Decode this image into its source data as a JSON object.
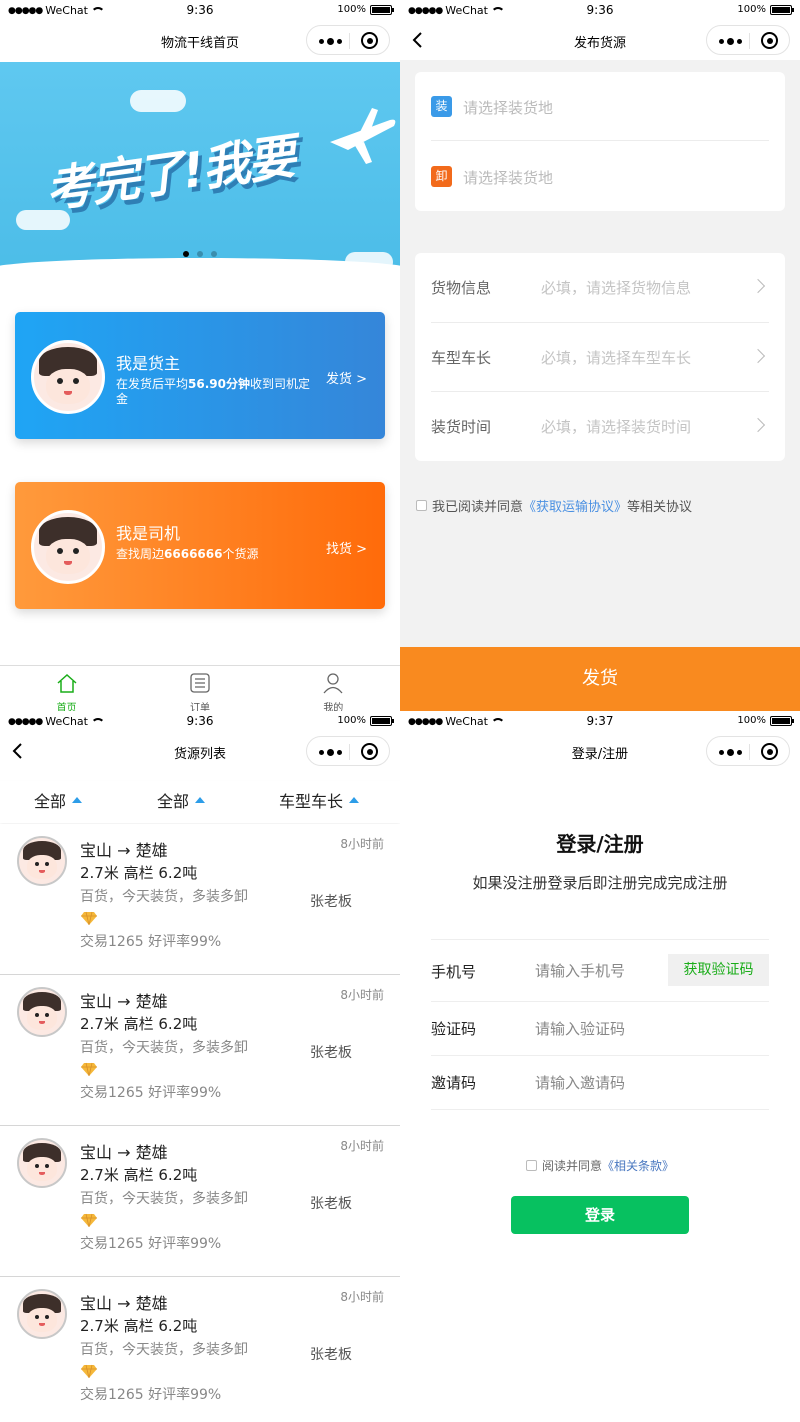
{
  "status": {
    "carrier": "WeChat",
    "battery": "100%",
    "time_1": "9:36",
    "time_2": "9:36",
    "time_3": "9:36",
    "time_4": "9:37"
  },
  "home": {
    "nav_title": "物流干线首页",
    "banner_text": "考完了!我要",
    "banner_slide_count": 3,
    "banner_active_index": 0,
    "shipper": {
      "title": "我是货主",
      "desc_prefix": "在发货后平均",
      "desc_value": "56.90分钟",
      "desc_suffix": "收到司机定金",
      "action": "发货 >",
      "color_start": "#1fa5f5",
      "color_end": "#3586d9"
    },
    "driver": {
      "title": "我是司机",
      "desc_prefix": "查找周边",
      "desc_value": "6666666",
      "desc_suffix": "个货源",
      "action": "找货 >",
      "color_start": "#ff9a3c",
      "color_end": "#ff6b0a"
    },
    "tabs": [
      {
        "label": "首页",
        "icon": "home-icon",
        "active": true
      },
      {
        "label": "订单",
        "icon": "list-icon",
        "active": false
      },
      {
        "label": "我的",
        "icon": "user-icon",
        "active": false
      }
    ],
    "active_color": "#1aad19"
  },
  "publish": {
    "nav_title": "发布货源",
    "load_tag": "装",
    "load_placeholder": "请选择装货地",
    "unload_tag": "卸",
    "unload_placeholder": "请选择装货地",
    "rows": [
      {
        "label": "货物信息",
        "placeholder": "必填，请选择货物信息"
      },
      {
        "label": "车型车长",
        "placeholder": "必填，请选择车型车长"
      },
      {
        "label": "装货时间",
        "placeholder": "必填，请选择装货时间"
      }
    ],
    "agree_prefix": "我已阅读并同意",
    "agree_link": "《获取运输协议》",
    "agree_suffix": "等相关协议",
    "submit": "发货",
    "submit_color": "#f98a1f"
  },
  "list": {
    "nav_title": "货源列表",
    "filters": [
      "全部",
      "全部",
      "车型车长"
    ],
    "items": [
      {
        "route": "宝山 → 楚雄",
        "spec": "2.7米 高栏 6.2吨",
        "goods": "百货，今天装货，多装多卸",
        "stats": "交易1265 好评率99%",
        "ago": "8小时前",
        "name": "张老板"
      },
      {
        "route": "宝山 → 楚雄",
        "spec": "2.7米 高栏 6.2吨",
        "goods": "百货，今天装货，多装多卸",
        "stats": "交易1265 好评率99%",
        "ago": "8小时前",
        "name": "张老板"
      },
      {
        "route": "宝山 → 楚雄",
        "spec": "2.7米 高栏 6.2吨",
        "goods": "百货，今天装货，多装多卸",
        "stats": "交易1265 好评率99%",
        "ago": "8小时前",
        "name": "张老板"
      },
      {
        "route": "宝山 → 楚雄",
        "spec": "2.7米 高栏 6.2吨",
        "goods": "百货，今天装货，多装多卸",
        "stats": "交易1265 好评率99%",
        "ago": "8小时前",
        "name": "张老板"
      }
    ]
  },
  "login": {
    "nav_title": "登录/注册",
    "title": "登录/注册",
    "subtitle": "如果没注册登录后即注册完成完成注册",
    "phone_label": "手机号",
    "phone_placeholder": "请输入手机号",
    "get_code": "获取验证码",
    "code_label": "验证码",
    "code_placeholder": "请输入验证码",
    "invite_label": "邀请码",
    "invite_placeholder": "请输入邀请码",
    "agree_prefix": "阅读并同意",
    "agree_link": "《相关条款》",
    "submit": "登录",
    "submit_color": "#07c160"
  }
}
